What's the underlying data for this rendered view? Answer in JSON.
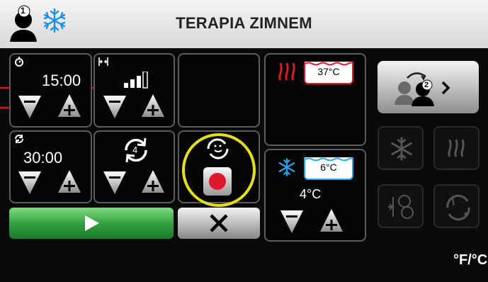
{
  "header": {
    "title": "TERAPIA ZIMNEM",
    "user_number": "1",
    "user_icon": "user-icon",
    "mode_icon": "snowflake-icon"
  },
  "timer1": {
    "value": "15:00",
    "icon": "stopwatch-icon"
  },
  "intensity": {
    "icon": "compression-icon",
    "level_bars": 3,
    "level_max": 4
  },
  "timer2": {
    "value": "30:00",
    "icon": "cycle-timer-icon"
  },
  "cycles": {
    "value": "4",
    "icon": "cycle-count-icon"
  },
  "record": {
    "icon": "record-icon"
  },
  "heat": {
    "temperature": "37°C",
    "icon": "heat-icon"
  },
  "cold": {
    "temperature": "6°C",
    "setpoint": "4°C",
    "icon": "snowflake-icon"
  },
  "side": {
    "switch_user_number": "2"
  },
  "unit_toggle": "°F/°C",
  "colors": {
    "green": "#3db050",
    "red": "#e0182d",
    "blue": "#2aa4e8",
    "highlight": "#e6dd1a"
  }
}
